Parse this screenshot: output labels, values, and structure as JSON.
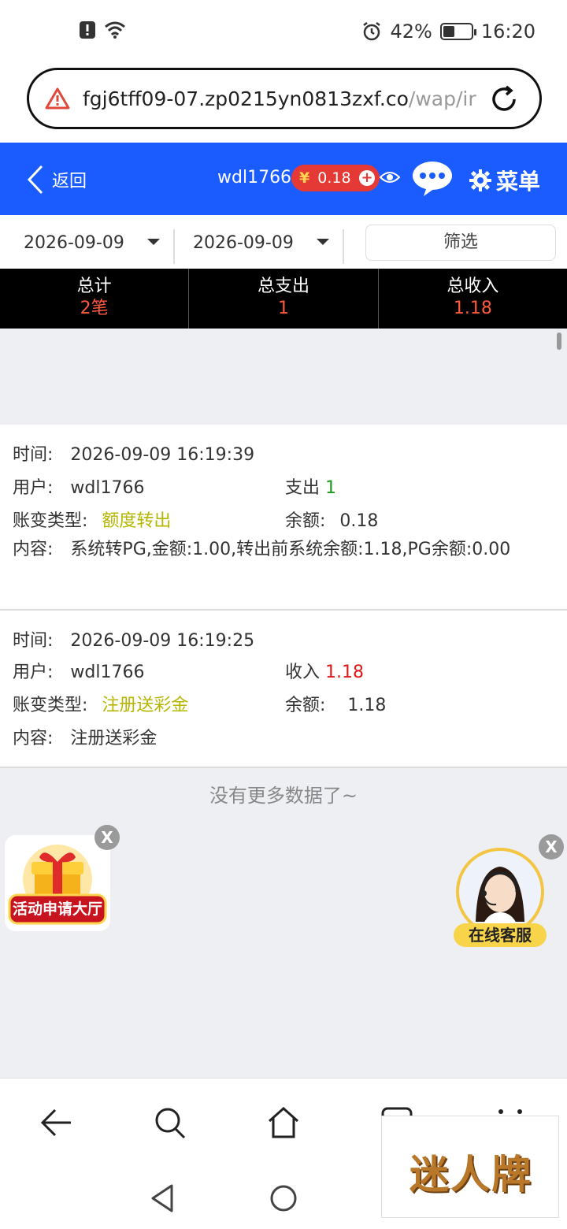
{
  "status_bar": {
    "battery": "42%",
    "time": "16:20"
  },
  "browser": {
    "url_main": "fgj6tff09-07.zp0215yn0813zxf.co",
    "url_path": "/wap/ir"
  },
  "header": {
    "back_label": "返回",
    "username": "wdl1766",
    "currency": "¥",
    "balance": "0.18",
    "menu_label": "菜单"
  },
  "filter": {
    "start_date": "2026-09-09",
    "end_date": "2026-09-09",
    "filter_label": "筛选"
  },
  "totals": {
    "count_label": "总计",
    "count_value": "2笔",
    "expense_label": "总支出",
    "expense_value": "1",
    "income_label": "总收入",
    "income_value": "1.18"
  },
  "labels": {
    "time": "时间:",
    "user": "用户:",
    "type": "账变类型:",
    "balance": "余额:",
    "content": "内容:"
  },
  "records": [
    {
      "time": "2026-09-09 16:19:39",
      "user": "wdl1766",
      "flow_label": "支出",
      "flow_value": "1",
      "type": "额度转出",
      "balance": "0.18",
      "content": "系统转PG,金额:1.00,转出前系统余额:1.18,PG余额:0.00"
    },
    {
      "time": "2026-09-09 16:19:25",
      "user": "wdl1766",
      "flow_label": "收入",
      "flow_value": "1.18",
      "type": "注册送彩金",
      "balance": "1.18",
      "content": "注册送彩金"
    }
  ],
  "no_more": "没有更多数据了~",
  "promo": {
    "label": "活动申请大厅"
  },
  "service": {
    "label": "在线客服"
  },
  "close_label": "X",
  "watermark": "迷人牌",
  "colors": {
    "header_blue": "#1a5cff",
    "accent_red": "#e53935",
    "type_yellow": "#b5b600"
  }
}
